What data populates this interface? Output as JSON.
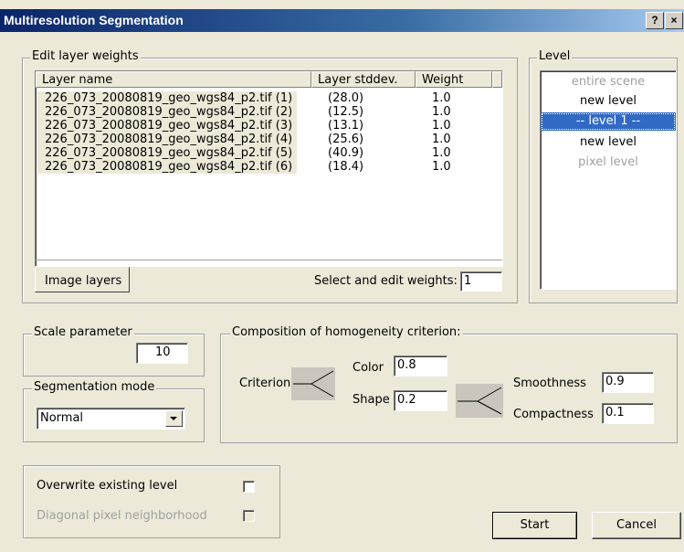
{
  "window": {
    "title": "Multiresolution Segmentation",
    "help_label": "?",
    "close_label": "×"
  },
  "layer_weights": {
    "group_label": "Edit layer weights",
    "columns": [
      "Layer name",
      "Layer stddev.",
      "Weight"
    ],
    "rows": [
      {
        "name": "226_073_20080819_geo_wgs84_p2.tif (1)",
        "stddev": "(28.0)",
        "weight": "1.0"
      },
      {
        "name": "226_073_20080819_geo_wgs84_p2.tif (2)",
        "stddev": "(12.5)",
        "weight": "1.0"
      },
      {
        "name": "226_073_20080819_geo_wgs84_p2.tif (3)",
        "stddev": "(13.1)",
        "weight": "1.0"
      },
      {
        "name": "226_073_20080819_geo_wgs84_p2.tif (4)",
        "stddev": "(25.6)",
        "weight": "1.0"
      },
      {
        "name": "226_073_20080819_geo_wgs84_p2.tif (5)",
        "stddev": "(40.9)",
        "weight": "1.0"
      },
      {
        "name": "226_073_20080819_geo_wgs84_p2.tif (6)",
        "stddev": "(18.4)",
        "weight": "1.0"
      }
    ],
    "tab_label": "Image layers",
    "select_label": "Select and edit weights:",
    "select_value": "1"
  },
  "level": {
    "group_label": "Level",
    "items": [
      {
        "label": "entire scene",
        "state": "disabled"
      },
      {
        "label": "new level",
        "state": "normal"
      },
      {
        "label": "-- level 1 --",
        "state": "selected"
      },
      {
        "label": "new level",
        "state": "normal"
      },
      {
        "label": "pixel level",
        "state": "disabled"
      }
    ]
  },
  "scale": {
    "group_label": "Scale parameter",
    "value": "10"
  },
  "segmentation_mode": {
    "group_label": "Segmentation mode",
    "value": "Normal"
  },
  "homogeneity": {
    "group_label": "Composition of homogeneity criterion:",
    "criterion_label": "Criterion",
    "color_label": "Color",
    "color_value": "0.8",
    "shape_label": "Shape",
    "shape_value": "0.2",
    "smoothness_label": "Smoothness",
    "smoothness_value": "0.9",
    "compactness_label": "Compactness",
    "compactness_value": "0.1"
  },
  "options": {
    "overwrite_label": "Overwrite existing level",
    "diagonal_label": "Diagonal pixel neighborhood"
  },
  "buttons": {
    "start": "Start",
    "cancel": "Cancel"
  }
}
